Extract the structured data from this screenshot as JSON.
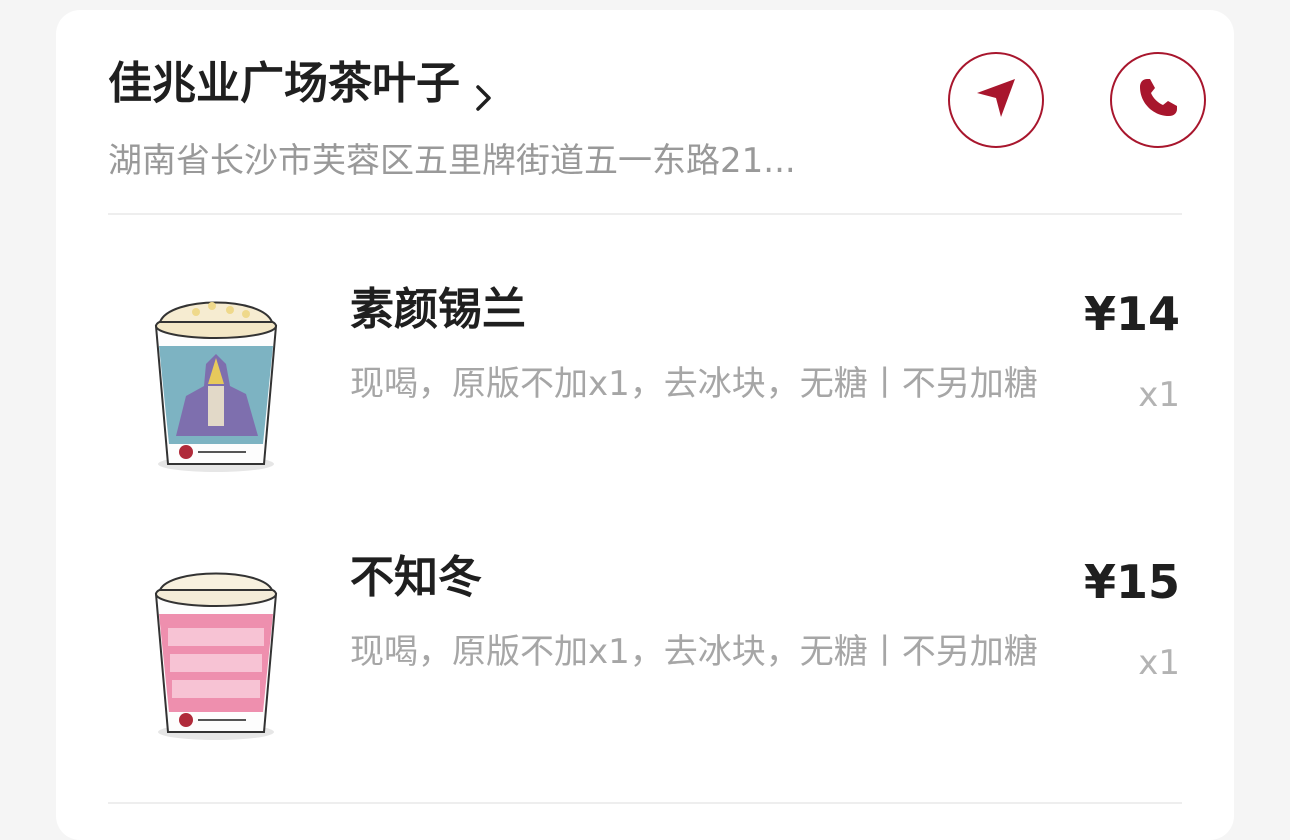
{
  "store": {
    "name": "佳兆业广场茶叶子",
    "address": "湖南省长沙市芙蓉区五里牌街道五一东路21..."
  },
  "icons": {
    "chevron": "chevron-right-icon",
    "navigate": "navigation-arrow-icon",
    "phone": "phone-icon"
  },
  "colors": {
    "accent": "#a8162d",
    "text_primary": "#1f1f1f",
    "text_secondary": "#999999"
  },
  "items": [
    {
      "name": "素颜锡兰",
      "spec": "现喝，原版不加x1，去冰块，无糖丨不另加糖",
      "price": "¥14",
      "qty": "x1",
      "image": "milk-tea-cup-blue-illustration"
    },
    {
      "name": "不知冬",
      "spec": "现喝，原版不加x1，去冰块，无糖丨不另加糖",
      "price": "¥15",
      "qty": "x1",
      "image": "milk-tea-cup-pink-illustration"
    }
  ]
}
